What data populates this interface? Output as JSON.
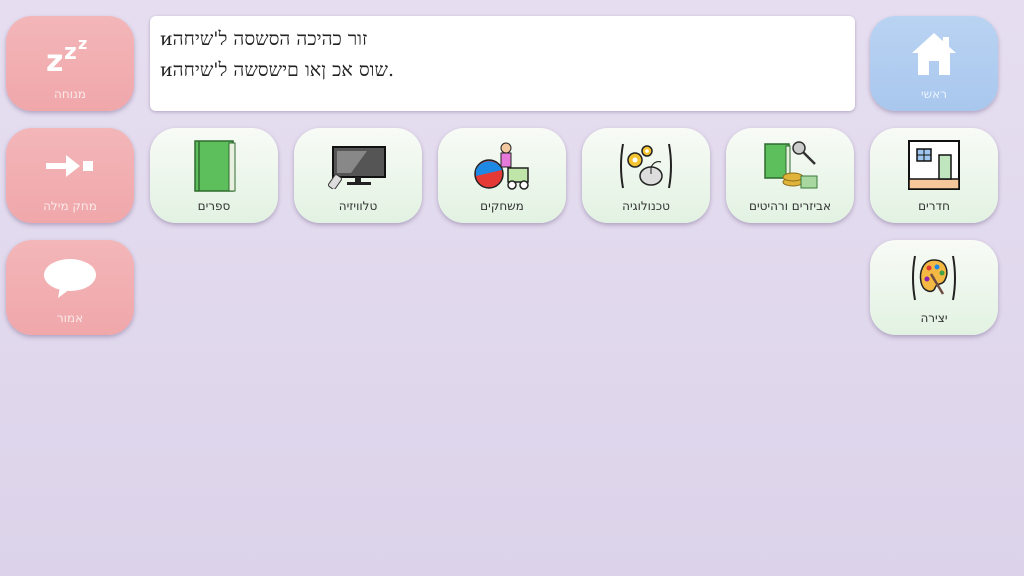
{
  "message_box": {
    "line1": "ᴎזור כהיכה הסשסה ל'שיחה",
    "line2": "ᴎשוס אכ ןאו םישסשה ל'שיחה."
  },
  "buttons": {
    "rest": "מנוחה",
    "home": "ראשי",
    "delete_word": "מחק מילה",
    "say": "אמור",
    "books": "ספרים",
    "tv": "טלוויזיה",
    "games": "משחקים",
    "technology": "טכנולוגיה",
    "objects": "אביזרים ורהיטים",
    "rooms": "חדרים",
    "creation": "יצירה"
  },
  "colors": {
    "action_tile": "#f0a7aa",
    "home_tile": "#a9c7ee",
    "category_tile": "#e2f2e2"
  }
}
